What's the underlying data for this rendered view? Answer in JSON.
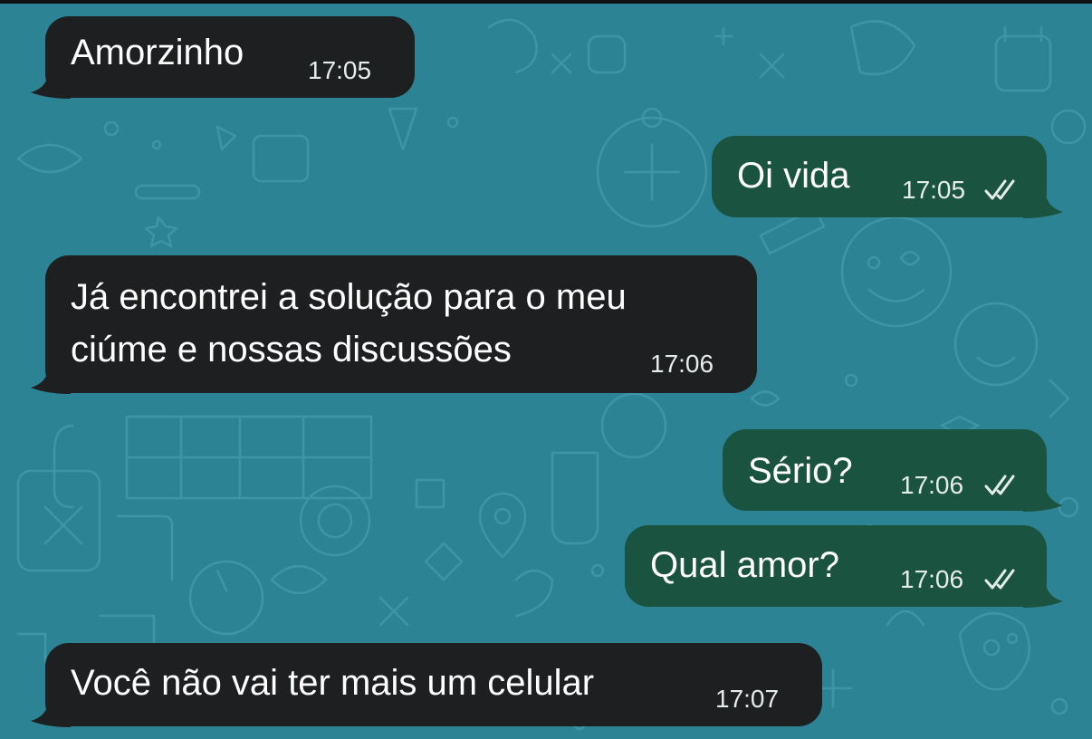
{
  "chat": {
    "messages": [
      {
        "direction": "incoming",
        "lines": [
          "Amorzinho"
        ],
        "time": "17:05"
      },
      {
        "direction": "outgoing",
        "lines": [
          "Oi vida"
        ],
        "time": "17:05",
        "status": "read",
        "status_icon": "double-check-icon"
      },
      {
        "direction": "incoming",
        "lines": [
          "Já encontrei a solução para o meu",
          "ciúme e nossas discussões"
        ],
        "time": "17:06"
      },
      {
        "direction": "outgoing",
        "lines": [
          "Sério?"
        ],
        "time": "17:06",
        "status": "read",
        "status_icon": "double-check-icon"
      },
      {
        "direction": "outgoing",
        "lines": [
          "Qual amor?"
        ],
        "time": "17:06",
        "status": "read",
        "status_icon": "double-check-icon"
      },
      {
        "direction": "incoming",
        "lines": [
          "Você não vai ter mais um celular"
        ],
        "time": "17:07"
      }
    ]
  },
  "theme": {
    "wallpaper": "#2c8394",
    "incoming_bubble": "#1d1f21",
    "outgoing_bubble": "#1a5440",
    "text": "#ffffff",
    "timestamp": "#e6ecea"
  }
}
